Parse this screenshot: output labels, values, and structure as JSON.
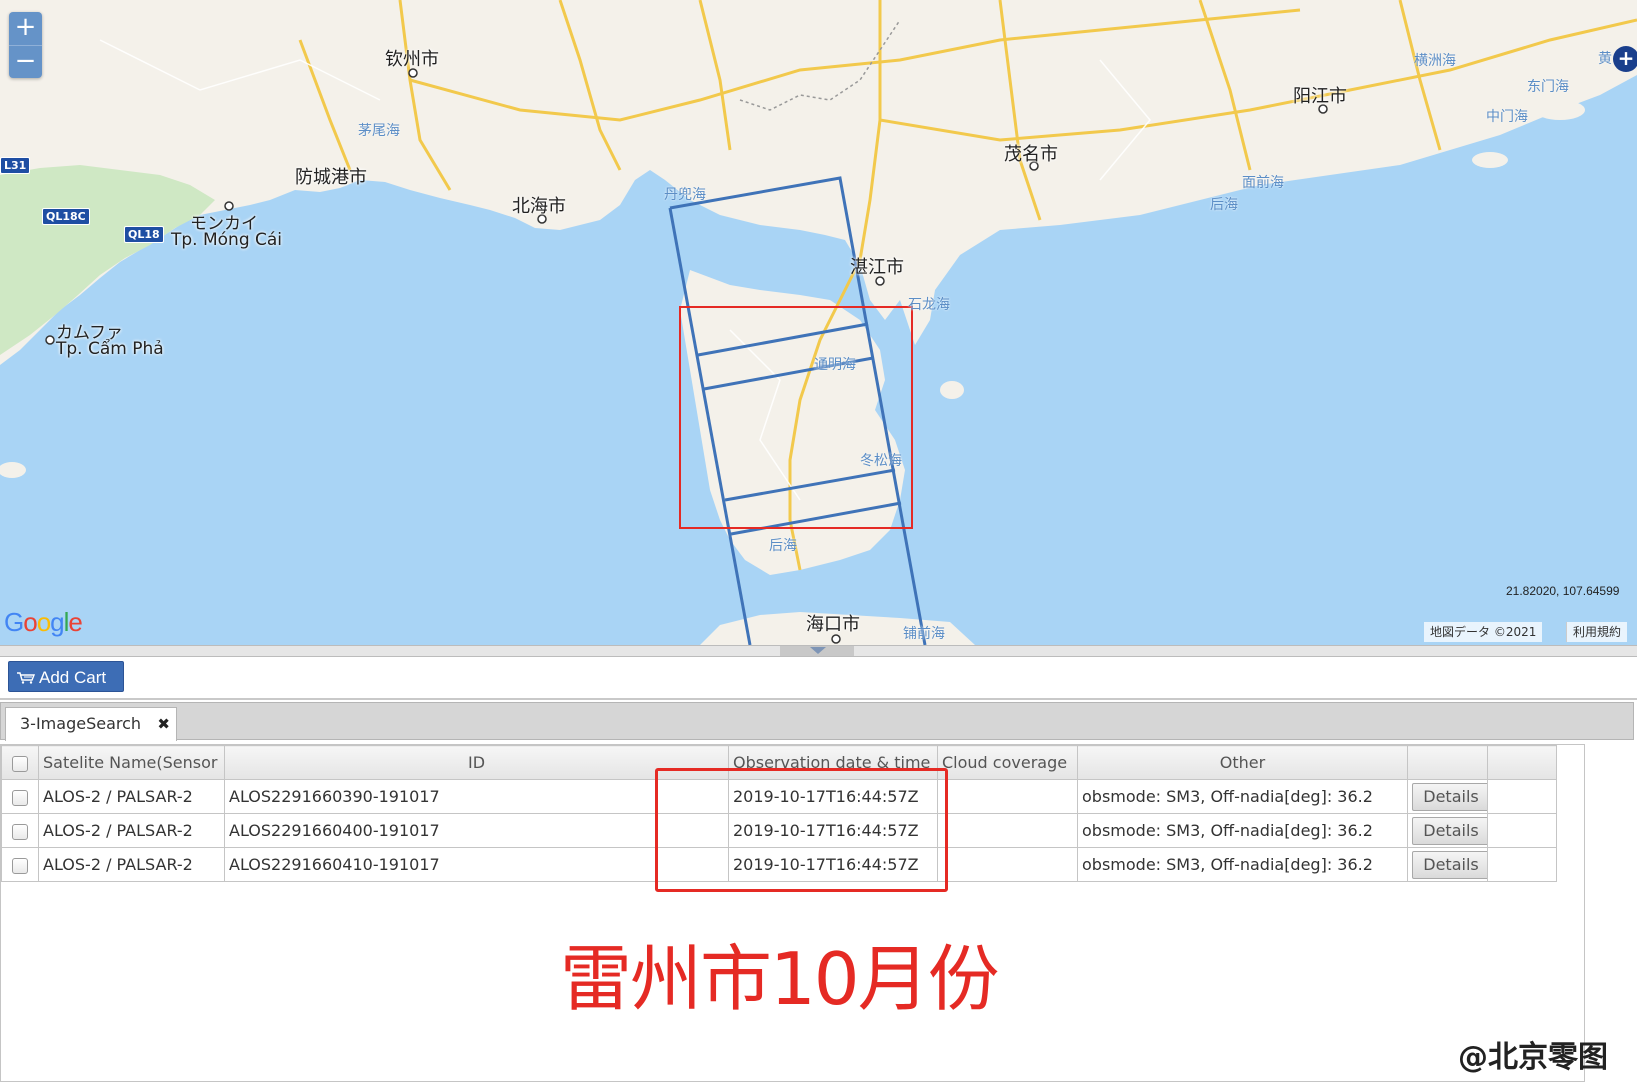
{
  "map": {
    "zoom_in": "+",
    "zoom_out": "−",
    "fullscreen": "+",
    "cities": [
      "钦州市",
      "防城港市",
      "北海市",
      "湛江市",
      "茂名市",
      "阳江市",
      "海口市"
    ],
    "vn_places": {
      "moncai_kana": "モンカイ",
      "moncai": "Tp. Móng Cái",
      "campha_kana": "カムファ",
      "campha": "Tp. Cẩm Phả"
    },
    "seas": [
      "茅尾海",
      "丹兜海",
      "石龙海",
      "通明海",
      "冬松海",
      "后海",
      "铺前海",
      "面前海",
      "后海",
      "横洲海",
      "东门海",
      "中门海",
      "黄"
    ],
    "road_badges": [
      "L31",
      "QL18C",
      "QL18"
    ],
    "coordinates": "21.82020, 107.64599",
    "google_logo": "Google",
    "attribution": "地図データ ©2021",
    "terms": "利用規約"
  },
  "toolbar": {
    "add_cart_label": "Add Cart"
  },
  "tabs": [
    {
      "label": "3-ImageSearch",
      "close": "✖"
    }
  ],
  "grid": {
    "columns": [
      "Satelite Name(Sensor I",
      "ID",
      "Observation date & time",
      "Cloud coverage",
      "Other",
      "",
      ""
    ],
    "details_label": "Details",
    "rows": [
      {
        "sat": "ALOS-2 / PALSAR-2",
        "id": "ALOS2291660390-191017",
        "date": "2019-10-17T16:44:57Z",
        "cloud": "",
        "other": "obsmode: SM3, Off-nadia[deg]: 36.2"
      },
      {
        "sat": "ALOS-2 / PALSAR-2",
        "id": "ALOS2291660400-191017",
        "date": "2019-10-17T16:44:57Z",
        "cloud": "",
        "other": "obsmode: SM3, Off-nadia[deg]: 36.2"
      },
      {
        "sat": "ALOS-2 / PALSAR-2",
        "id": "ALOS2291660410-191017",
        "date": "2019-10-17T16:44:57Z",
        "cloud": "",
        "other": "obsmode: SM3, Off-nadia[deg]: 36.2"
      }
    ]
  },
  "caption": "雷州市10月份",
  "watermark": "@北京零图",
  "colors": {
    "accent": "#3d6db5",
    "highlight": "#e52a24",
    "footprint": "#3f73b8",
    "aoi": "#e52a24",
    "sea": "#a9d4f5",
    "land": "#f4f1ea"
  }
}
